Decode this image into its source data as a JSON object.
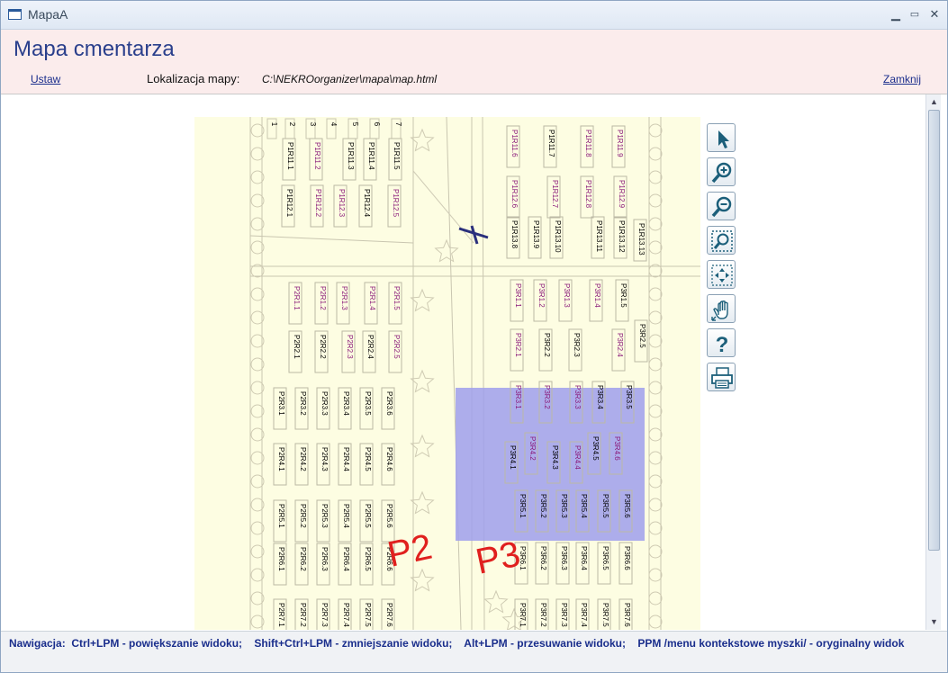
{
  "window": {
    "title": "MapaA"
  },
  "window_buttons": {
    "minimize": "▁",
    "maximize": "▭",
    "close": "✕"
  },
  "header": {
    "page_title": "Mapa cmentarza",
    "ustaw_label": "Ustaw",
    "location_label": "Lokalizacja mapy:",
    "location_value": "C:\\NEKROorganizer\\mapa\\map.html",
    "close_label": "Zamknij"
  },
  "map": {
    "background": "#fdfde2",
    "highlight_color": "#9f9fec",
    "sector_labels": [
      "P2",
      "P3"
    ],
    "top_numbers": [
      "1",
      "2",
      "3",
      "4",
      "5",
      "6",
      "7"
    ],
    "plots_p1": [
      "P1R11.1",
      "P1R11.2",
      "P1R11.3",
      "P1R11.4",
      "P1R11.5",
      "P1R12.1",
      "P1R12.2",
      "P1R12.3",
      "P1R12.4",
      "P1R12.5",
      "P1R11.6",
      "P1R11.7",
      "P1R11.8",
      "P1R11.9",
      "P1R12.6",
      "P1R12.7",
      "P1R12.8",
      "P1R12.9",
      "P1R13.8",
      "P1R13.9",
      "P1R13.10",
      "P1R13.11",
      "P1R13.12",
      "P1R13.13"
    ],
    "plots_p2": [
      "P2R1.1",
      "P2R1.2",
      "P2R1.3",
      "P2R1.4",
      "P2R1.5",
      "P2R2.1",
      "P2R2.2",
      "P2R2.3",
      "P2R2.4",
      "P2R2.5",
      "P2R3.1",
      "P2R3.2",
      "P2R3.3",
      "P2R3.4",
      "P2R3.5",
      "P2R3.6",
      "P2R4.1",
      "P2R4.2",
      "P2R4.3",
      "P2R4.4",
      "P2R4.5",
      "P2R4.6",
      "P2R5.1",
      "P2R5.2",
      "P2R5.3",
      "P2R5.4",
      "P2R5.5",
      "P2R5.6",
      "P2R6.1",
      "P2R6.2",
      "P2R6.3",
      "P2R6.4",
      "P2R6.5",
      "P2R6.6",
      "P2R7.1",
      "P2R7.2",
      "P2R7.3",
      "P2R7.4",
      "P2R7.5",
      "P2R7.6"
    ],
    "plots_p3": [
      "P3R1.1",
      "P3R1.2",
      "P3R1.3",
      "P3R1.4",
      "P3R1.5",
      "P3R2.1",
      "P3R2.2",
      "P3R2.3",
      "P3R2.4",
      "P3R2.5",
      "P3R3.1",
      "P3R3.2",
      "P3R3.3",
      "P3R3.4",
      "P3R3.5",
      "P3R4.1",
      "P3R4.2",
      "P3R4.3",
      "P3R4.4",
      "P3R4.5",
      "P3R4.6",
      "P3R5.1",
      "P3R5.2",
      "P3R5.3",
      "P3R5.4",
      "P3R5.5",
      "P3R5.6",
      "P3R6.1",
      "P3R6.2",
      "P3R6.3",
      "P3R6.4",
      "P3R6.5",
      "P3R6.6",
      "P3R7.1",
      "P3R7.2",
      "P3R7.3",
      "P3R7.4",
      "P3R7.5",
      "P3R7.6"
    ]
  },
  "tools": [
    {
      "name": "select-pointer-icon"
    },
    {
      "name": "zoom-in-icon"
    },
    {
      "name": "zoom-out-icon"
    },
    {
      "name": "zoom-region-icon"
    },
    {
      "name": "fit-view-icon"
    },
    {
      "name": "pan-hand-icon"
    },
    {
      "name": "help-icon"
    },
    {
      "name": "print-icon"
    }
  ],
  "statusbar": {
    "navigation": "Nawigacja:  Ctrl+LPM - powiększanie widoku;    Shift+Ctrl+LPM - zmniejszanie widoku;    Alt+LPM - przesuwanie widoku;    PPM /menu kontekstowe myszki/ - oryginalny widok"
  }
}
